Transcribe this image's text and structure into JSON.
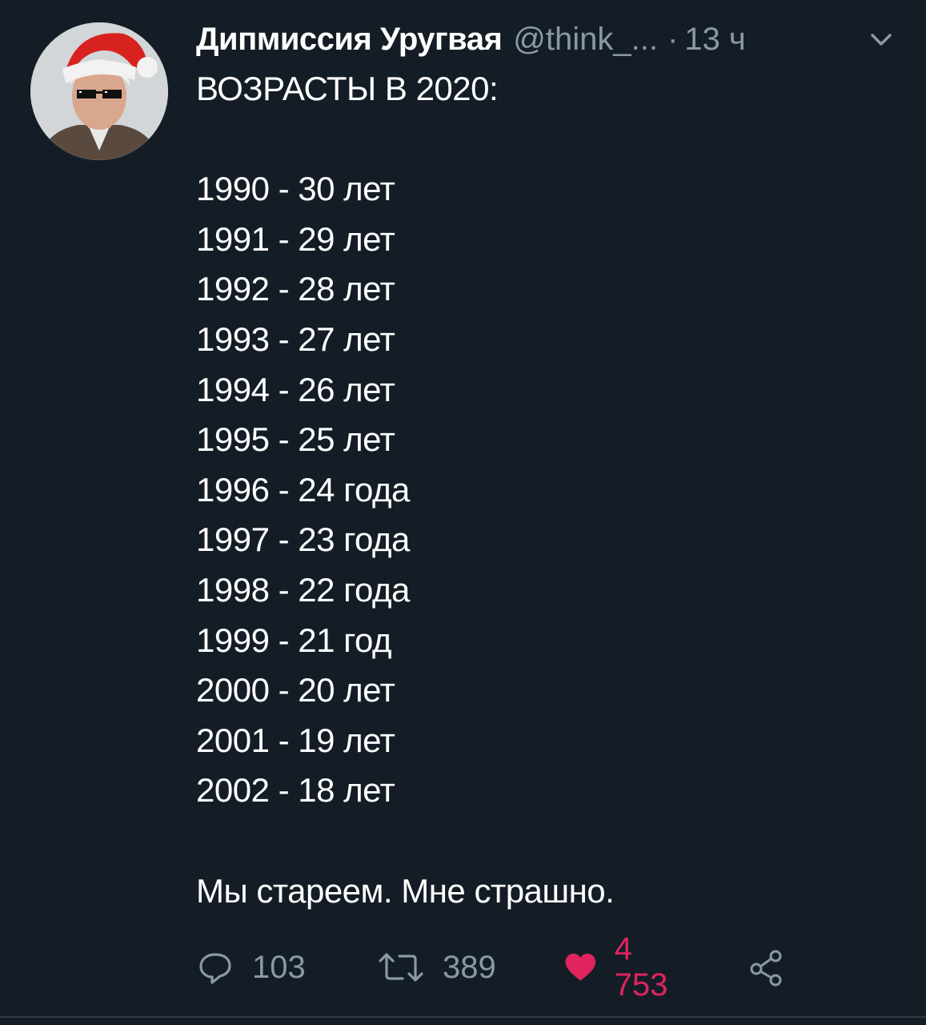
{
  "tweet": {
    "author_name": "Дипмиссия Уругвая",
    "author_handle": "@think_...",
    "separator": "·",
    "time_ago": "13 ч",
    "heading": "ВОЗРАСТЫ В 2020:",
    "lines": [
      "1990 - 30 лет",
      "1991 - 29 лет",
      "1992 - 28 лет",
      "1993 - 27 лет",
      "1994 - 26 лет",
      "1995 - 25 лет",
      "1996 - 24 года",
      "1997 - 23 года",
      "1998 - 22 года",
      "1999 - 21 год",
      "2000 - 20 лет",
      "2001 - 19 лет",
      "2002 - 18 лет"
    ],
    "closing": "Мы стареем. Мне страшно."
  },
  "actions": {
    "reply_count": "103",
    "retweet_count": "389",
    "like_count": "4 753"
  },
  "icons": {
    "reply": "reply-icon",
    "retweet": "retweet-icon",
    "like": "heart-icon",
    "share": "share-icon",
    "menu": "chevron-down-icon"
  },
  "colors": {
    "background": "#141d26",
    "text": "#ffffff",
    "secondary": "#8899a6",
    "like": "#e0245e"
  }
}
